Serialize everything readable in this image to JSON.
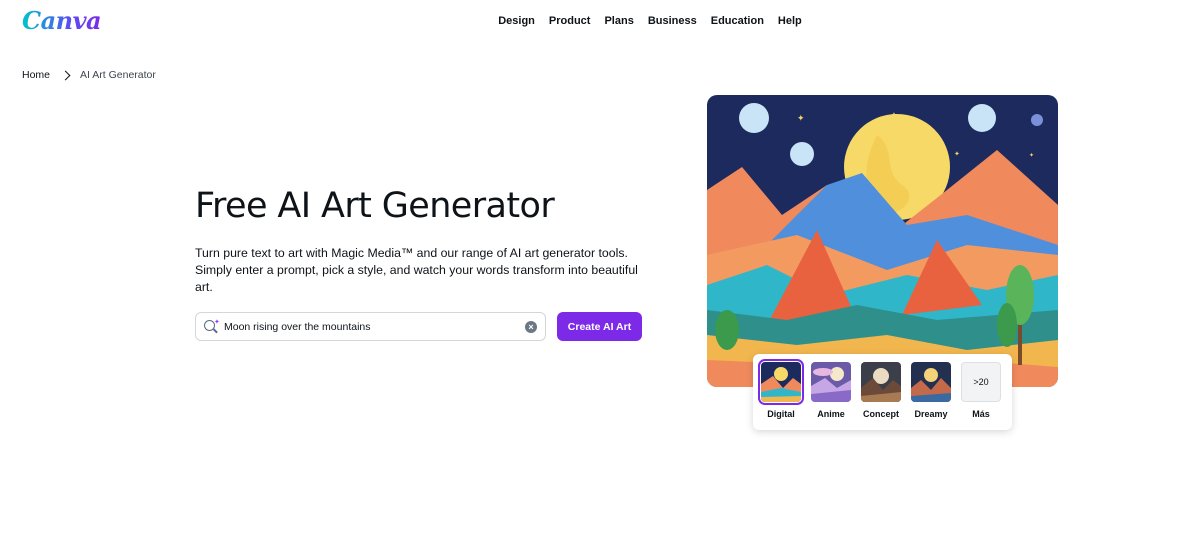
{
  "header": {
    "logo": "Canva",
    "nav": [
      "Design",
      "Product",
      "Plans",
      "Business",
      "Education",
      "Help"
    ]
  },
  "breadcrumb": {
    "home": "Home",
    "current": "AI Art Generator"
  },
  "hero": {
    "title": "Free AI Art Generator",
    "description": "Turn pure text to art with Magic Media™ and our range of AI art generator tools. Simply enter a prompt, pick a style, and watch your words transform into beautiful art."
  },
  "prompt": {
    "value": "Moon rising over the mountains",
    "button": "Create AI Art"
  },
  "styles": {
    "selected": "Digital",
    "items": [
      "Digital",
      "Anime",
      "Concept",
      "Dreamy"
    ],
    "more_count": ">20",
    "more_label": "Más"
  },
  "colors": {
    "accent": "#7d2ae8",
    "text": "#0e1318"
  }
}
